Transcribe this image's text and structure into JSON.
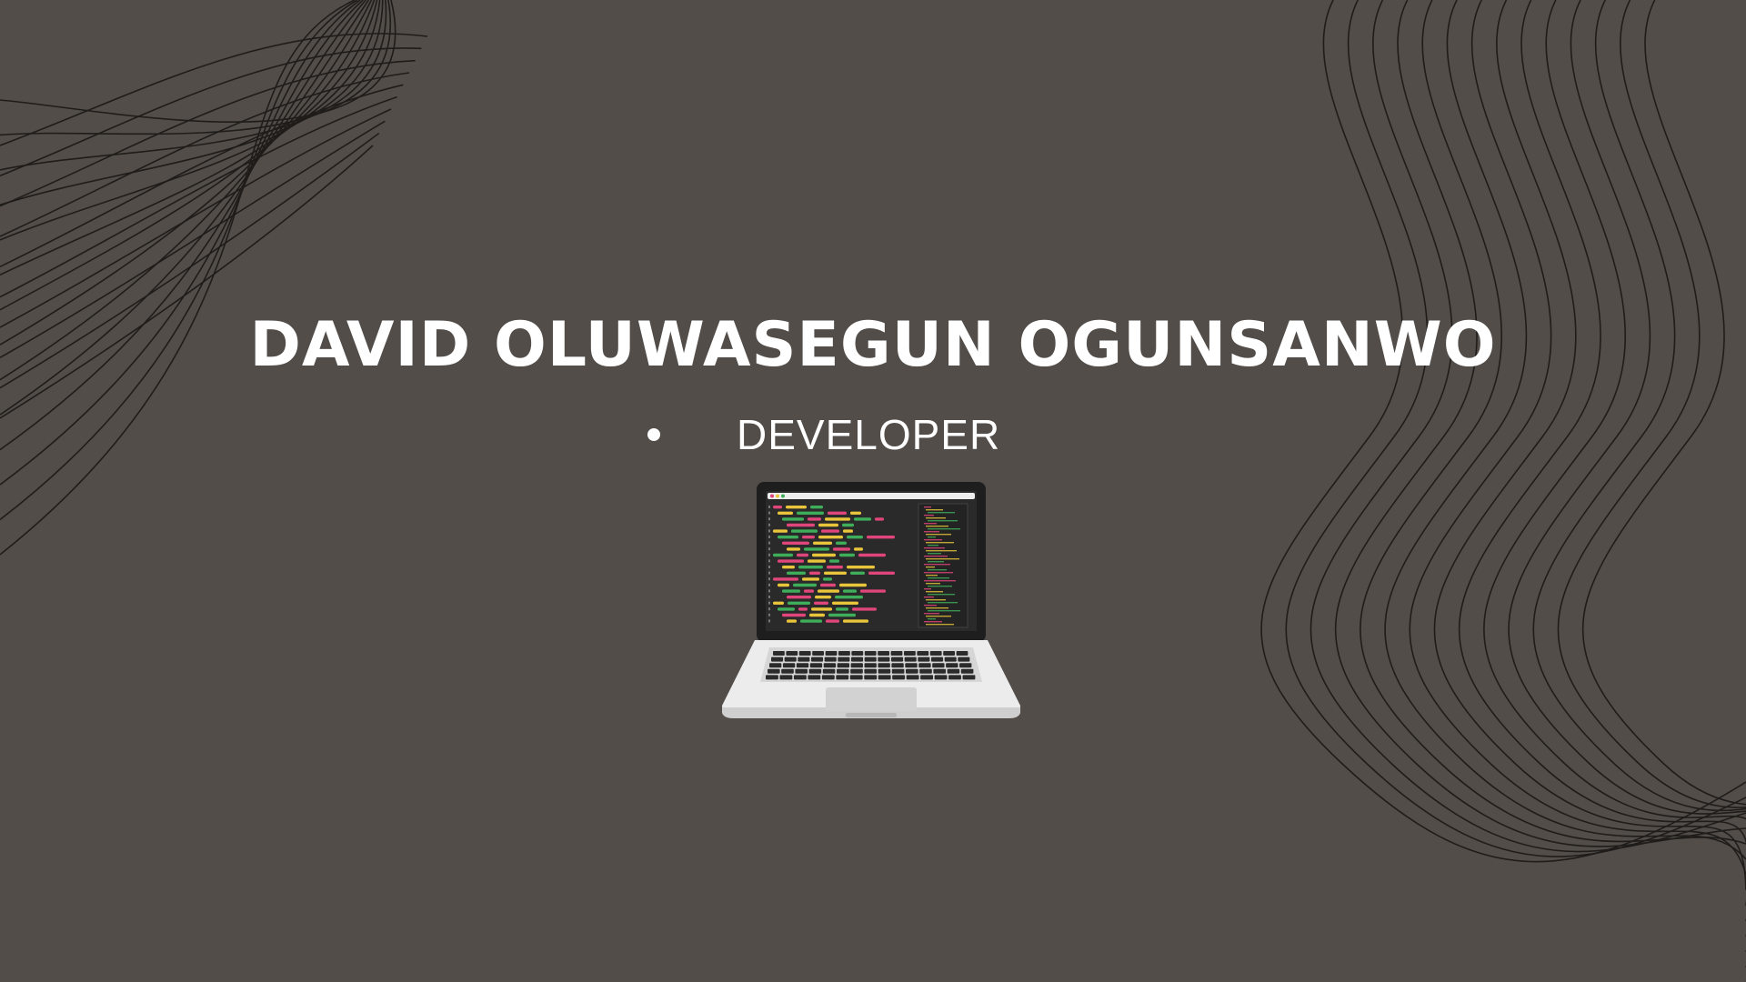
{
  "hero": {
    "name": "DAVID OLUWASEGUN OGUNSANWO",
    "role": "DEVELOPER"
  },
  "illustration": {
    "icon": "laptop-code-icon"
  },
  "colors": {
    "background": "#524d49",
    "text": "#ffffff",
    "lines": "#1f1c1a",
    "code_pink": "#e0457b",
    "code_yellow": "#e8c53a",
    "code_green": "#3fae5a"
  }
}
